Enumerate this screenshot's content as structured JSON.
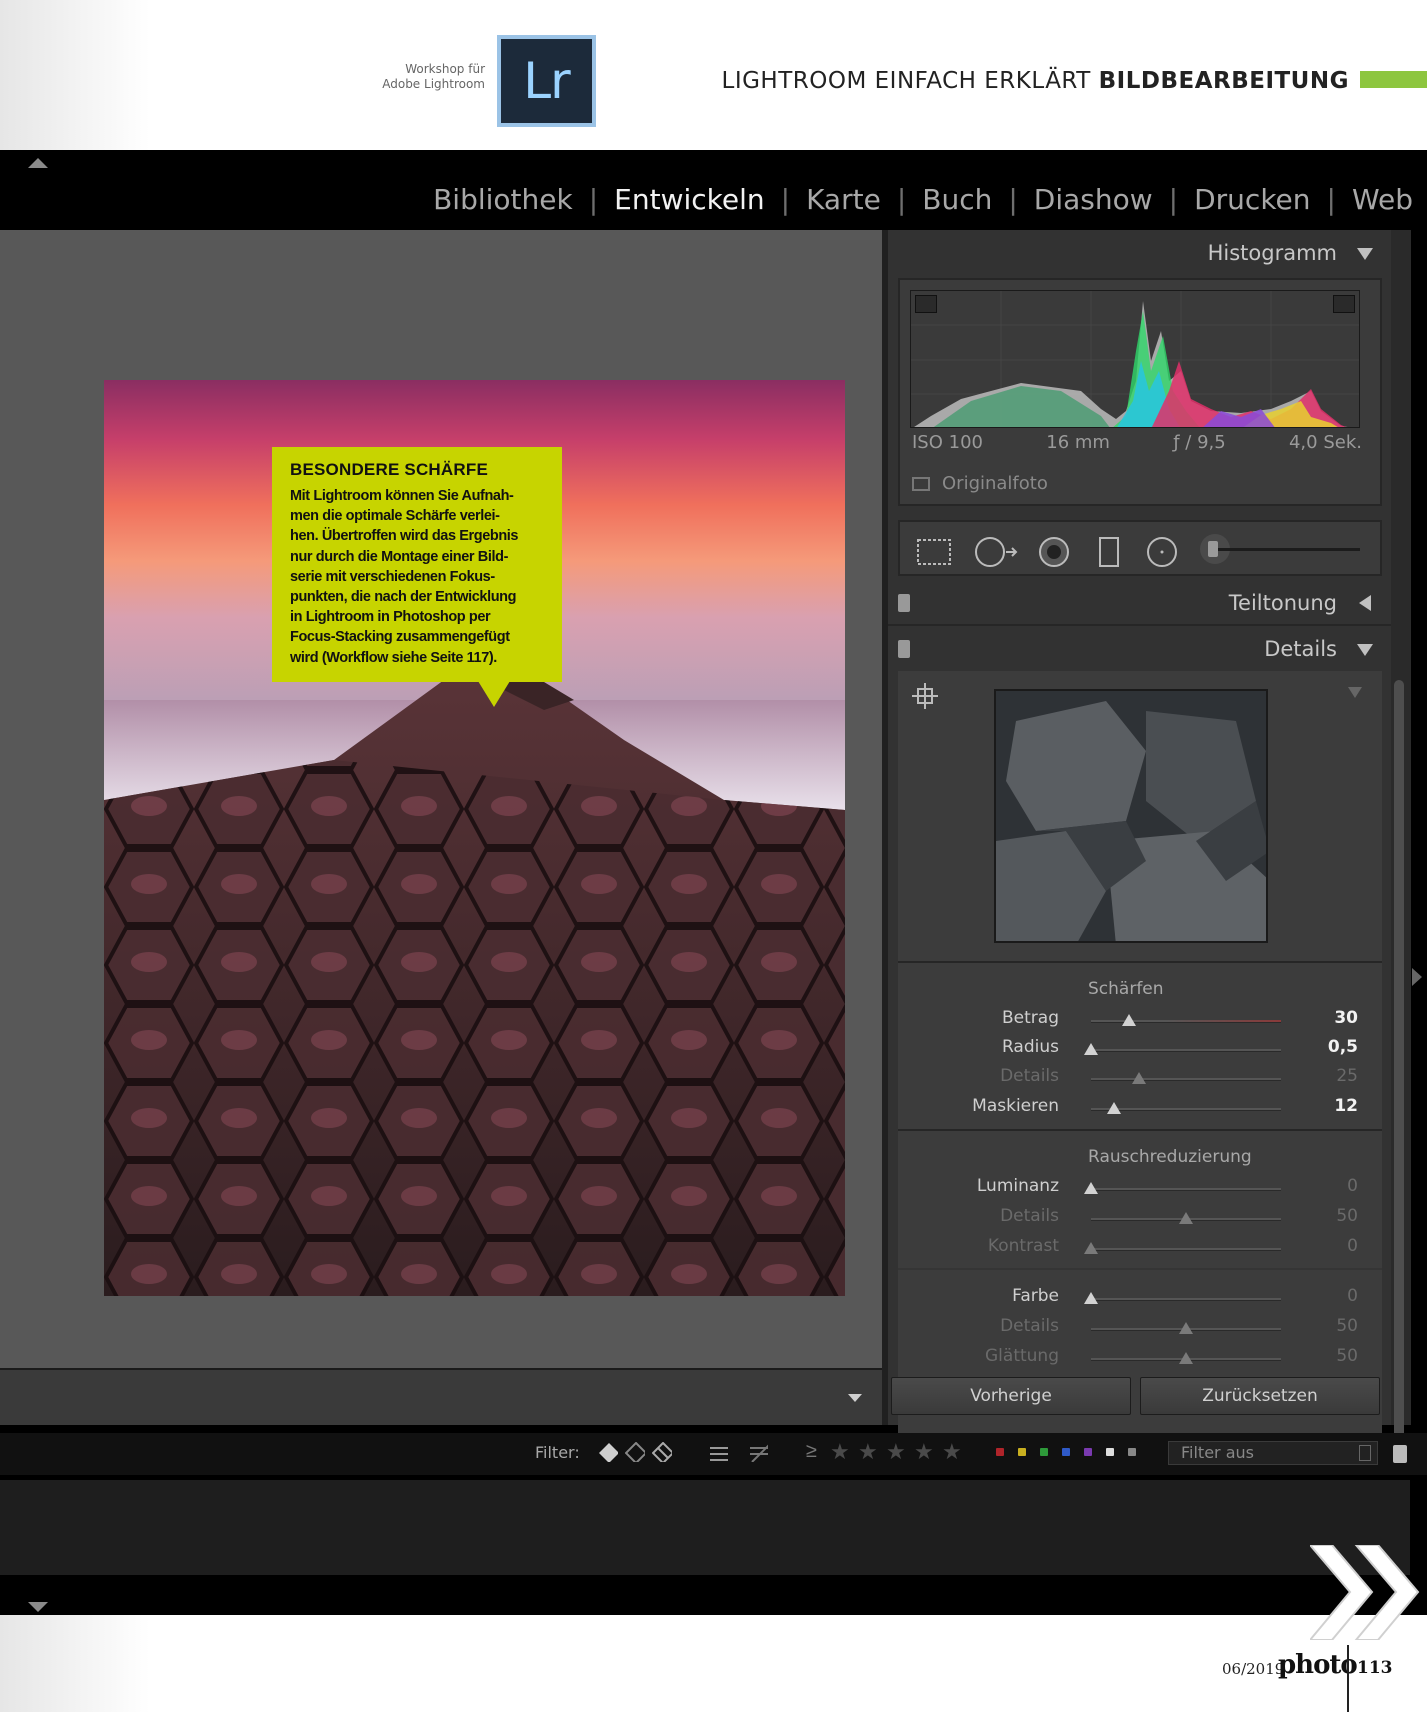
{
  "magazine": {
    "workshop_line1": "Workshop für",
    "workshop_line2": "Adobe Lightroom",
    "logo_text": "Lr",
    "title_regular": "LIGHTROOM EINFACH ERKLÄRT",
    "title_bold": "BILDBEARBEITUNG",
    "accent_green": "#8dc63f",
    "footer_date": "06/2019",
    "footer_brand": "photo",
    "page_number": "113"
  },
  "modules": [
    "Bibliothek",
    "Entwickeln",
    "Karte",
    "Buch",
    "Diashow",
    "Drucken",
    "Web"
  ],
  "active_module": "Entwickeln",
  "callout": {
    "title": "BESONDERE SCHÄRFE",
    "lines": [
      "Mit Lightroom können Sie Aufnah-",
      "men die optimale Schärfe verlei-",
      "hen. Übertroffen wird das Ergebnis",
      "nur durch die Montage einer Bild-",
      "serie mit verschiedenen Fokus-",
      "punkten, die nach der Entwicklung",
      "in Lightroom in Photoshop per",
      "Focus-Stacking zusammengefügt",
      "wird (Workflow siehe Seite 117)."
    ],
    "color": "#c7d400"
  },
  "histogram": {
    "title": "Histogramm",
    "iso": "ISO 100",
    "focal": "16 mm",
    "aperture": "ƒ / 9,5",
    "shutter": "4,0 Sek.",
    "original_label": "Originalfoto"
  },
  "panels": {
    "split_toning": "Teiltonung",
    "details": "Details"
  },
  "sharpening": {
    "title": "Schärfen",
    "sliders": [
      {
        "label": "Betrag",
        "value": "30",
        "pos": 0.2,
        "enabled": true
      },
      {
        "label": "Radius",
        "value": "0,5",
        "pos": 0.0,
        "enabled": true
      },
      {
        "label": "Details",
        "value": "25",
        "pos": 0.25,
        "enabled": false
      },
      {
        "label": "Maskieren",
        "value": "12",
        "pos": 0.12,
        "enabled": true
      }
    ]
  },
  "noise": {
    "title": "Rauschreduzierung",
    "sliders": [
      {
        "label": "Luminanz",
        "value": "0",
        "pos": 0.0,
        "enabled": true
      },
      {
        "label": "Details",
        "value": "50",
        "pos": 0.5,
        "enabled": false
      },
      {
        "label": "Kontrast",
        "value": "0",
        "pos": 0.0,
        "enabled": false
      },
      {
        "label": "Farbe",
        "value": "0",
        "pos": 0.0,
        "enabled": true
      },
      {
        "label": "Details",
        "value": "50",
        "pos": 0.5,
        "enabled": false
      },
      {
        "label": "Glättung",
        "value": "50",
        "pos": 0.5,
        "enabled": false
      }
    ]
  },
  "buttons": {
    "previous": "Vorherige",
    "reset": "Zurücksetzen"
  },
  "filter": {
    "label": "Filter:",
    "rating_op": "≥",
    "select_value": "Filter aus",
    "label_colors": [
      "#b0242a",
      "#c9b020",
      "#2e9a3a",
      "#2f5ac8",
      "#7a3ab0",
      "#dddddd",
      "#888888"
    ]
  }
}
